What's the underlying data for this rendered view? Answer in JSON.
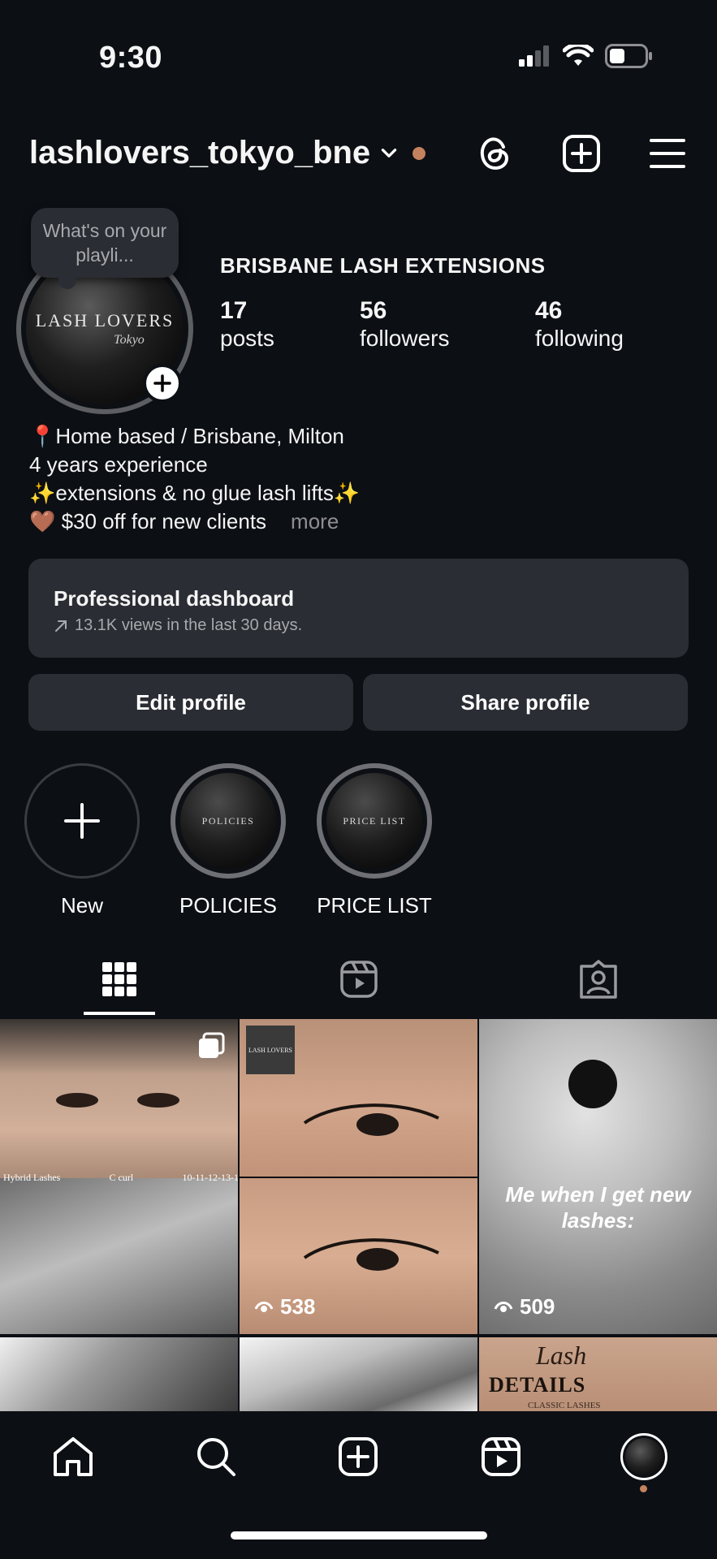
{
  "status_bar": {
    "time": "9:30"
  },
  "header": {
    "username": "lashlovers_tokyo_bne",
    "icons": [
      "chevron-down-icon",
      "threads-icon",
      "create-icon",
      "menu-icon"
    ],
    "notification_dot_color": "#c5825e"
  },
  "profile": {
    "note": "What's on your playli...",
    "avatar_text": "LASH LOVERS",
    "avatar_subtext": "Tokyo",
    "full_name": "BRISBANE LASH EXTENSIONS",
    "stats": [
      {
        "value": "17",
        "label": "posts"
      },
      {
        "value": "56",
        "label": "followers"
      },
      {
        "value": "46",
        "label": "following"
      }
    ],
    "bio": [
      "📍Home based / Brisbane, Milton",
      "4 years experience",
      "✨extensions & no glue lash lifts✨",
      "🤎 $30 off for new clients"
    ],
    "bio_more": "more"
  },
  "dashboard": {
    "title": "Professional dashboard",
    "subtitle": "13.1K views in the last 30 days."
  },
  "actions": {
    "edit": "Edit profile",
    "share": "Share profile"
  },
  "highlights": [
    {
      "label": "New"
    },
    {
      "label": "POLICIES",
      "cover_text": "POLICIES"
    },
    {
      "label": "PRICE LIST",
      "cover_text": "PRICE LIST"
    }
  ],
  "tabs": [
    "grid-icon",
    "reels-icon",
    "tagged-icon"
  ],
  "grid": {
    "post1": {
      "caption_left": "Hybrid Lashes",
      "caption_mid": "C curl",
      "caption_right": "10-11-12-13-1"
    },
    "post2": {
      "logo": "LASH LOVERS",
      "views": "538"
    },
    "post3": {
      "overlay": "Me when I get new lashes:",
      "views": "509"
    },
    "post6": {
      "title": "Lash",
      "subtitle": "DETAILS",
      "tag": "CLASSIC LASHES"
    }
  },
  "bottom_nav": [
    "home-icon",
    "search-icon",
    "create-icon",
    "reels-icon",
    "profile-avatar"
  ],
  "colors": {
    "background": "#0c0f14",
    "card": "#2a2d33",
    "accent": "#c5825e"
  }
}
